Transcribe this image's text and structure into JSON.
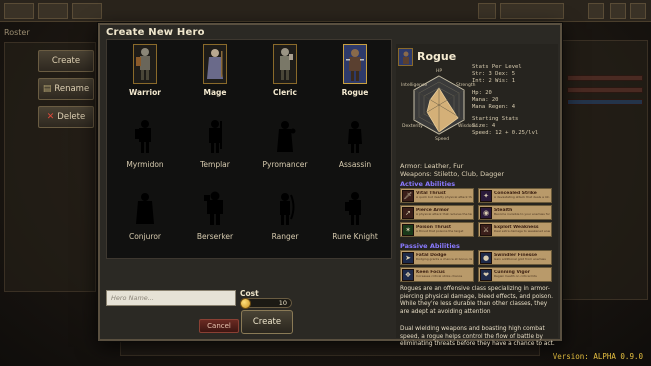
{
  "modal": {
    "title": "Create New Hero"
  },
  "side_buttons": {
    "create": "Create",
    "rename": "Rename",
    "delete": "Delete"
  },
  "background": {
    "roster_label": "Roster"
  },
  "heroes": [
    {
      "name": "Warrior",
      "unlocked": true
    },
    {
      "name": "Mage",
      "unlocked": true
    },
    {
      "name": "Cleric",
      "unlocked": true
    },
    {
      "name": "Rogue",
      "unlocked": true,
      "selected": true
    },
    {
      "name": "Myrmidon",
      "unlocked": false
    },
    {
      "name": "Templar",
      "unlocked": false
    },
    {
      "name": "Pyromancer",
      "unlocked": false
    },
    {
      "name": "Assassin",
      "unlocked": false
    },
    {
      "name": "Conjuror",
      "unlocked": false
    },
    {
      "name": "Berserker",
      "unlocked": false
    },
    {
      "name": "Ranger",
      "unlocked": false
    },
    {
      "name": "Rune Knight",
      "unlocked": false
    }
  ],
  "form": {
    "name_placeholder": "Hero Name...",
    "cost_label": "Cost",
    "cost_value": "10",
    "cancel_label": "Cancel",
    "create_label": "Create"
  },
  "detail": {
    "title": "Rogue",
    "radar_labels": {
      "top": "HP",
      "upper_left": "Intelligence",
      "upper_right": "Strength",
      "lower_left": "Dexterity",
      "lower_right": "Wisdom",
      "bottom": "Speed"
    },
    "stats_header": "Stats Per Level",
    "stats_lines": [
      "Str:  3   Dex:  5",
      "Int:  2   Wis:  1"
    ],
    "vitals": [
      "Hp:        20",
      "Mana:      20",
      "Mana Regen:  4"
    ],
    "starting_header": "Starting Stats",
    "starting_lines": [
      "Size: 4",
      "Speed: 12 + 0.25/lvl"
    ],
    "armor": "Armor: Leather, Fur",
    "weapons": "Weapons: Stiletto, Club, Dagger",
    "active_title": "Active Abilities",
    "active_abilities": [
      {
        "name": "Vital Thrust",
        "desc": "A quick but deadly physical attack that deals bonus damage"
      },
      {
        "name": "Concealed Strike",
        "desc": "A devastating attack that deals a lot of physical damage"
      },
      {
        "name": "Pierce Armor",
        "desc": "A physical attack that reduces the target's armor"
      },
      {
        "name": "Stealth",
        "desc": "Become invisible to your enemies for a duration"
      },
      {
        "name": "Poison Thrust",
        "desc": "A thrust that poisons the target"
      },
      {
        "name": "Exploit Weakness",
        "desc": "Deal extra damage to weakened enemies"
      }
    ],
    "passive_title": "Passive Abilities",
    "passive_abilities": [
      {
        "name": "Fatal Dodge",
        "desc": "Dodging grants a chance at bonus damage"
      },
      {
        "name": "Swindler Finesse",
        "desc": "Gain additional gold from enemies"
      },
      {
        "name": "Keen Focus",
        "desc": "Increases critical strike chance"
      },
      {
        "name": "Cunning Vigor",
        "desc": "Regain health on critical hits"
      }
    ],
    "desc1": "Rogues are an offensive class specializing in armor-piercing physical damage, bleed effects, and poison. While they're less durable than other classes, they are adept at avoiding attention",
    "desc2": "Dual wielding weapons and boasting high combat speed, a rogue helps control the flow of battle by eliminating threats before they have a chance to act."
  },
  "version": "Version: ALPHA 0.9.0",
  "colors": {
    "accent_gold": "#c8a040",
    "passive_title": "#8a7aff",
    "version_text": "#e6c040"
  }
}
